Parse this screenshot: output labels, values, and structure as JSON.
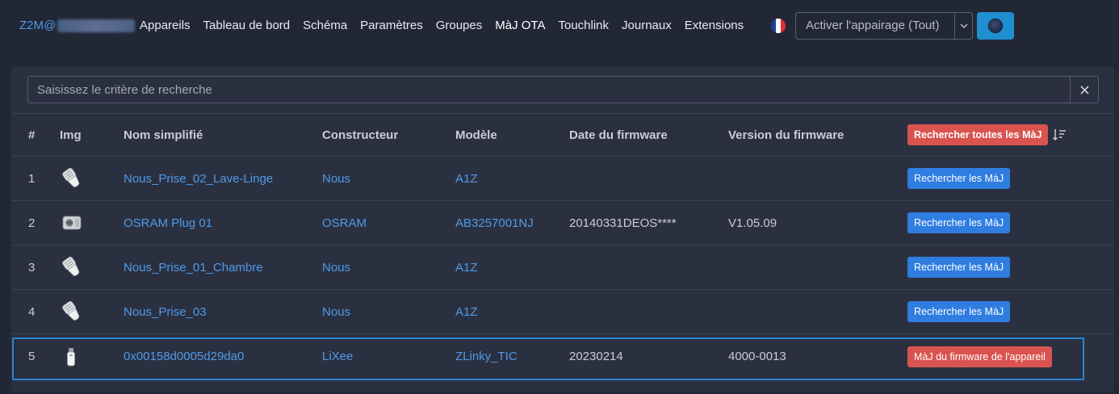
{
  "navbar": {
    "brand": "Z2M@",
    "links": [
      "Appareils",
      "Tableau de bord",
      "Schéma",
      "Paramètres",
      "Groupes",
      "MàJ OTA",
      "Touchlink",
      "Journaux",
      "Extensions"
    ],
    "active_link": "MàJ OTA",
    "pairing_label": "Activer l'appairage (Tout)"
  },
  "search": {
    "placeholder": "Saisissez le critère de recherche",
    "value": ""
  },
  "table": {
    "headers": {
      "index": "#",
      "img": "Img",
      "name": "Nom simplifié",
      "manufacturer": "Constructeur",
      "model": "Modèle",
      "fw_date": "Date du firmware",
      "fw_version": "Version du firmware"
    },
    "check_all_label": "Rechercher toutes les MàJ",
    "rows": [
      {
        "index": "1",
        "img": "bulb",
        "name": "Nous_Prise_02_Lave-Linge",
        "manufacturer": "Nous",
        "model": "A1Z",
        "fw_date": "",
        "fw_version": "",
        "action": "Rechercher les MàJ",
        "action_color": "blue"
      },
      {
        "index": "2",
        "img": "plug",
        "name": "OSRAM Plug 01",
        "manufacturer": "OSRAM",
        "model": "AB3257001NJ",
        "fw_date": "20140331DEOS****",
        "fw_version": "V1.05.09",
        "action": "Rechercher les MàJ",
        "action_color": "blue"
      },
      {
        "index": "3",
        "img": "bulb",
        "name": "Nous_Prise_01_Chambre",
        "manufacturer": "Nous",
        "model": "A1Z",
        "fw_date": "",
        "fw_version": "",
        "action": "Rechercher les MàJ",
        "action_color": "blue"
      },
      {
        "index": "4",
        "img": "bulb",
        "name": "Nous_Prise_03",
        "manufacturer": "Nous",
        "model": "A1Z",
        "fw_date": "",
        "fw_version": "",
        "action": "Rechercher les MàJ",
        "action_color": "blue"
      },
      {
        "index": "5",
        "img": "dongle",
        "name": "0x00158d0005d29da0",
        "manufacturer": "LiXee",
        "model": "ZLinky_TIC",
        "fw_date": "20230214",
        "fw_version": "4000-0013",
        "action": "MàJ du firmware de l'appareil",
        "action_color": "red"
      }
    ]
  },
  "colors": {
    "background": "#222736",
    "card": "#2b3040",
    "link": "#4f9ae8",
    "primary": "#2f7de0",
    "danger": "#d9534f",
    "selection": "#2785d6"
  },
  "icons": {
    "flag": "france-flag-icon",
    "theme": "theme-toggle-icon",
    "clear": "close-icon",
    "sort": "sort-descending-icon"
  }
}
